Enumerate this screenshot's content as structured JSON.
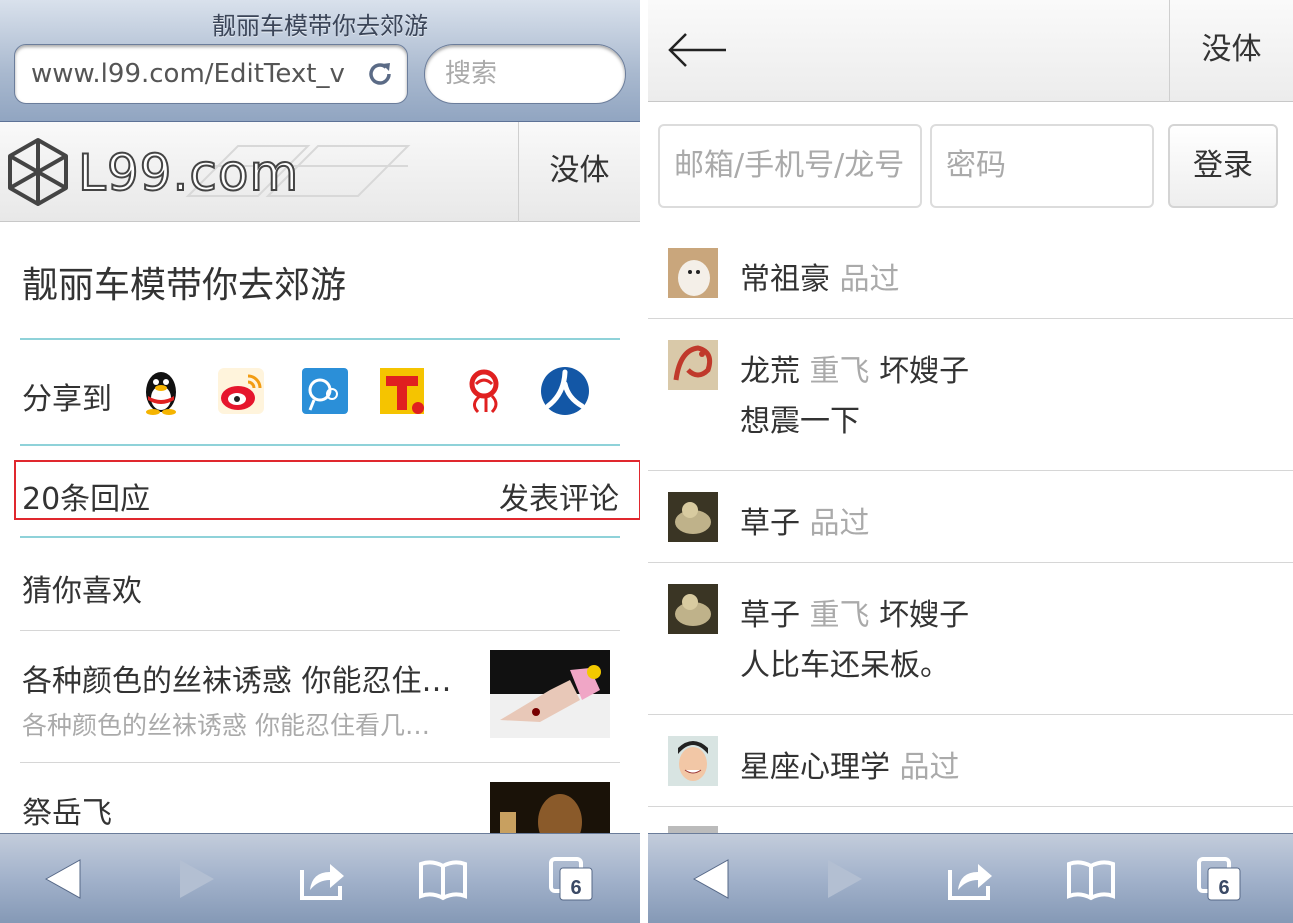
{
  "left": {
    "safari": {
      "title": "靓丽车模带你去郊游",
      "url": "www.l99.com/EditText_v",
      "search_placeholder": "搜索"
    },
    "site": {
      "logo_text": "L99.com",
      "font_button": "没体"
    },
    "article_title": "靓丽车模带你去郊游",
    "share": {
      "label": "分享到",
      "targets": [
        "qq-icon",
        "weibo-icon",
        "pengyou-icon",
        "tianya-icon",
        "sohu-icon",
        "renren-icon"
      ]
    },
    "replies": {
      "count_label": "20条回应",
      "post_label": "发表评论"
    },
    "guess_title": "猜你喜欢",
    "recommendations": [
      {
        "title": "各种颜色的丝袜诱惑 你能忍住…",
        "subtitle": "各种颜色的丝袜诱惑 你能忍住看几…"
      },
      {
        "title": "祭岳飞",
        "subtitle": ""
      }
    ],
    "toolbar": {
      "tabs_count": "6"
    }
  },
  "right": {
    "font_button": "没体",
    "login": {
      "account_placeholder": "邮箱/手机号/龙号",
      "password_placeholder": "密码",
      "submit_label": "登录"
    },
    "comments": [
      {
        "user": "常祖豪",
        "action": "品过",
        "target": "",
        "body": ""
      },
      {
        "user": "龙荒",
        "action": "重飞",
        "target": "坏嫂子",
        "body": "想震一下"
      },
      {
        "user": "草子",
        "action": "品过",
        "target": "",
        "body": ""
      },
      {
        "user": "草子",
        "action": "重飞",
        "target": "坏嫂子",
        "body": "人比车还呆板。"
      },
      {
        "user": "星座心理学",
        "action": "品过",
        "target": "",
        "body": ""
      }
    ],
    "toolbar": {
      "tabs_count": "6"
    }
  },
  "colors": {
    "toolbar_blue": "#8599b6",
    "rule_teal": "#8fd2d9",
    "highlight_red": "#e0282e",
    "muted_text": "#aaaaaa"
  }
}
